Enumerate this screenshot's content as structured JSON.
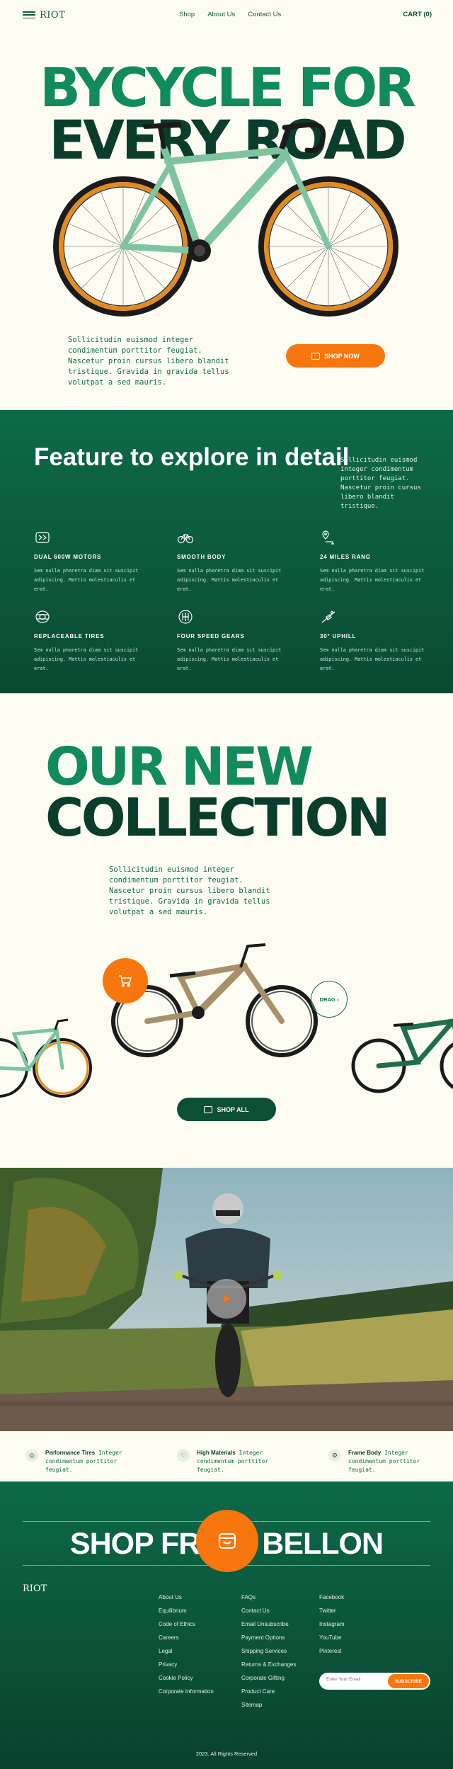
{
  "nav": {
    "logo": "RIOT",
    "links": [
      "Shop",
      "About Us",
      "Contact Us"
    ],
    "cart": "CART (0)"
  },
  "hero": {
    "title_line1": "BYCYCLE FOR",
    "title_line2": "EVERY ROAD",
    "text": "Sollicitudin euismod integer condimentum porttitor feugiat. Nascetur proin cursus libero blandit tristique. Gravida in gravida tellus volutpat a sed mauris.",
    "button": "SHOP NOW"
  },
  "features": {
    "title": "Feature to explore in detail",
    "side_text": "Sollicitudin euismod integer condimentum porttitor feugiat. Nascetur proin cursus libero blandit tristique.",
    "items": [
      {
        "name": "DUAL 600W MOTORS",
        "desc": "Sem nulla pharetra diam sit suscipit adipiscing. Mattis molestiaculis et erat.",
        "icon": "motor-icon"
      },
      {
        "name": "SMOOTH BODY",
        "desc": "Sem nulla pharetra diam sit suscipit adipiscing. Mattis molestiaculis et erat.",
        "icon": "bicycle-icon"
      },
      {
        "name": "24 MILES RANG",
        "desc": "Sem nulla pharetra diam sit suscipit adipiscing. Mattis molestiaculis et erat.",
        "icon": "route-pin-icon"
      },
      {
        "name": "REPLACEABLE TIRES",
        "desc": "Sem nulla pharetra diam sit suscipit adipiscing. Mattis molestiaculis et erat.",
        "icon": "tire-icon"
      },
      {
        "name": "FOUR SPEED GEARS",
        "desc": "Sem nulla pharetra diam sit suscipit adipiscing. Mattis molestiaculis et erat.",
        "icon": "gear-icon"
      },
      {
        "name": "30° UPHILL",
        "desc": "Sem nulla pharetra diam sit suscipit adipiscing. Mattis molestiaculis et erat.",
        "icon": "uphill-icon"
      }
    ]
  },
  "collection": {
    "title_line1": "OUR NEW",
    "title_line2": "COLLECTION",
    "text": "Sollicitudin euismod integer condimentum porttitor feugiat. Nascetur proin cursus libero blandit tristique. Gravida in gravida tellus volutpat a sed mauris.",
    "drag": "DRAG",
    "button": "SHOP ALL"
  },
  "specs": [
    {
      "title": "Performance Tires",
      "text": "Integer condimentum porttitor feugiat."
    },
    {
      "title": "High Materials",
      "text": "Integer condimentum porttitor feugiat."
    },
    {
      "title": "Frame Body",
      "text": "Integer condimentum porttitor feugiat."
    }
  ],
  "footer": {
    "shop_title_left": "SHOP FR",
    "shop_title_right": "BELLON",
    "logo": "RIOT",
    "col1": [
      "About Us",
      "Equilibrium",
      "Code of Ethics",
      "Careers",
      "Legal",
      "Privacy",
      "Cookie Policy",
      "Corporate Information"
    ],
    "col2": [
      "FAQs",
      "Contact Us",
      "Email Unsubscribe",
      "Payment Options",
      "Shipping Services",
      "Returns & Exchanges",
      "Corporate Gifting",
      "Product Care",
      "Sitemap"
    ],
    "col3": [
      "Facebook",
      "Twitter",
      "Instagram",
      "YouTube",
      "Pinterest"
    ],
    "email_placeholder": "Enter Your Email",
    "subscribe": "SUBSCRIBE",
    "copyright": "2023. All Rights Reserved"
  },
  "colors": {
    "brand_green": "#0d6a48",
    "dark_green": "#0a3d2b",
    "accent_orange": "#f7760e",
    "cream": "#fdfcf3"
  }
}
